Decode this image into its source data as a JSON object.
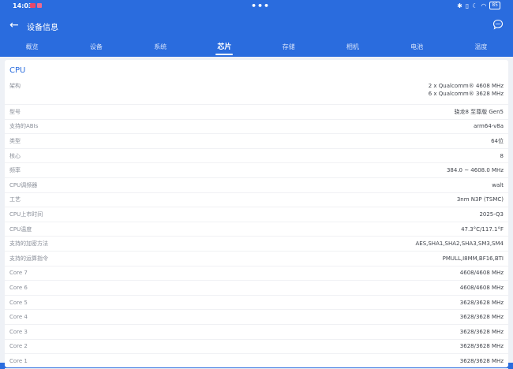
{
  "status_bar": {
    "time": "14:03",
    "battery": "85"
  },
  "app_bar": {
    "title": "设备信息"
  },
  "tabs": [
    "概览",
    "设备",
    "系统",
    "芯片",
    "存储",
    "相机",
    "电池",
    "温度"
  ],
  "active_tab": "芯片",
  "section": {
    "title": "CPU"
  },
  "rows": [
    {
      "label": "架构",
      "lines": [
        "2 x Qualcomm® 4608 MHz",
        "6 x Qualcomm® 3628 MHz"
      ]
    },
    {
      "label": "型号",
      "lines": [
        "骁龙8 至尊版 Gen5"
      ]
    },
    {
      "label": "支持的ABIs",
      "lines": [
        "arm64-v8a"
      ]
    },
    {
      "label": "类型",
      "lines": [
        "64位"
      ]
    },
    {
      "label": "核心",
      "lines": [
        "8"
      ]
    },
    {
      "label": "频率",
      "lines": [
        "384.0 ~ 4608.0 MHz"
      ]
    },
    {
      "label": "CPU调频器",
      "lines": [
        "walt"
      ]
    },
    {
      "label": "工艺",
      "lines": [
        "3nm N3P (TSMC)"
      ]
    },
    {
      "label": "CPU上市时间",
      "lines": [
        "2025-Q3"
      ]
    },
    {
      "label": "CPU温度",
      "lines": [
        "47.3°C/117.1°F"
      ]
    },
    {
      "label": "支持的加密方法",
      "lines": [
        "AES,SHA1,SHA2,SHA3,SM3,SM4"
      ]
    },
    {
      "label": "支持的运算指令",
      "lines": [
        "PMULL,I8MM,BF16,BTI"
      ]
    },
    {
      "label": "Core 7",
      "lines": [
        "4608/4608 MHz"
      ]
    },
    {
      "label": "Core 6",
      "lines": [
        "4608/4608 MHz"
      ]
    },
    {
      "label": "Core 5",
      "lines": [
        "3628/3628 MHz"
      ]
    },
    {
      "label": "Core 4",
      "lines": [
        "3628/3628 MHz"
      ]
    },
    {
      "label": "Core 3",
      "lines": [
        "3628/3628 MHz"
      ]
    },
    {
      "label": "Core 2",
      "lines": [
        "3628/3628 MHz"
      ]
    },
    {
      "label": "Core 1",
      "lines": [
        "3628/3628 MHz"
      ]
    }
  ],
  "colors": {
    "brand": "#2a6cde",
    "label": "#8a8f99",
    "value": "#40444c"
  }
}
